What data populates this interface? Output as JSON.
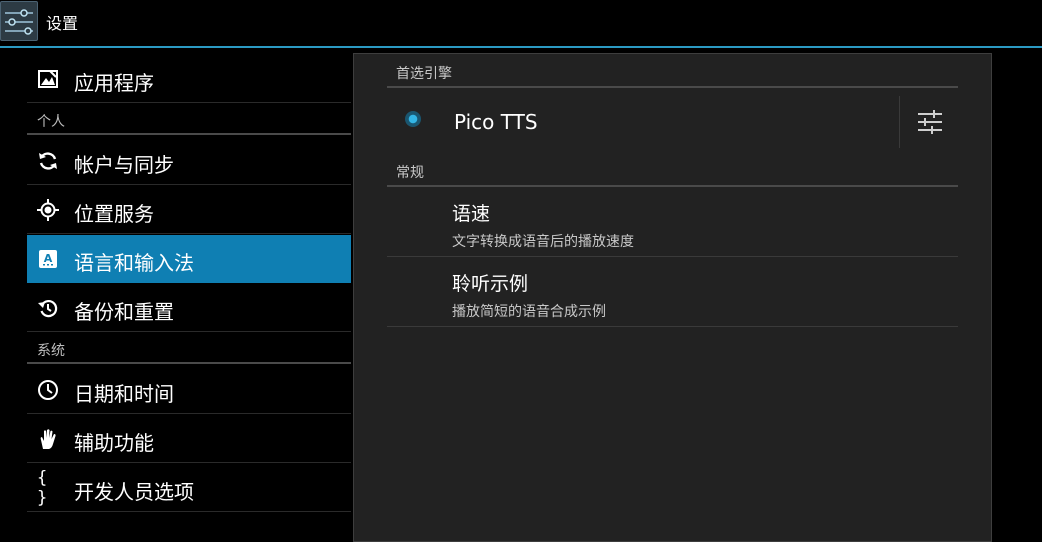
{
  "actionbar": {
    "title": "设置",
    "icon": "settings-sliders-icon",
    "accent_color": "#33b5e5"
  },
  "sidebar": {
    "items": [
      {
        "label": "应用程序",
        "icon": "apps-icon"
      },
      {
        "header": "个人"
      },
      {
        "label": "帐户与同步",
        "icon": "sync-icon"
      },
      {
        "label": "位置服务",
        "icon": "location-icon"
      },
      {
        "label": "语言和输入法",
        "icon": "language-icon",
        "selected": true
      },
      {
        "label": "备份和重置",
        "icon": "backup-icon"
      },
      {
        "header": "系统"
      },
      {
        "label": "日期和时间",
        "icon": "clock-icon"
      },
      {
        "label": "辅助功能",
        "icon": "accessibility-hand-icon"
      },
      {
        "label": "开发人员选项",
        "icon": "developer-braces-icon",
        "icon_text": "{ }"
      }
    ],
    "selected_color": "#0f7fb3"
  },
  "panel": {
    "engine_header": "首选引擎",
    "engine": {
      "name": "Pico TTS",
      "selected": true,
      "settings_icon": "equalizer-settings-icon"
    },
    "general_header": "常规",
    "prefs": [
      {
        "title": "语速",
        "summary": "文字转换成语音后的播放速度"
      },
      {
        "title": "聆听示例",
        "summary": "播放简短的语音合成示例"
      }
    ]
  }
}
